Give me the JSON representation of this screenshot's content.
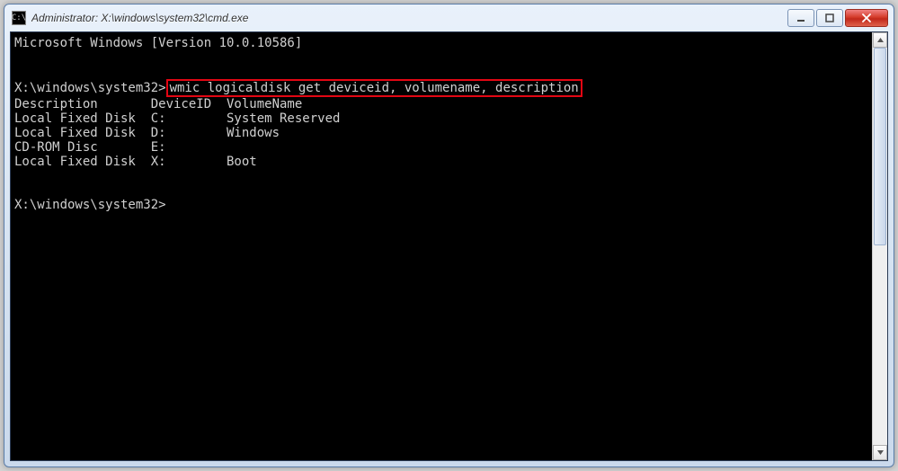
{
  "window": {
    "title": "Administrator: X:\\windows\\system32\\cmd.exe"
  },
  "terminal": {
    "version_line": "Microsoft Windows [Version 10.0.10586]",
    "prompt1_prefix": "X:\\windows\\system32>",
    "command1": "wmic logicaldisk get deviceid, volumename, description",
    "header": "Description       DeviceID  VolumeName",
    "rows": [
      "Local Fixed Disk  C:        System Reserved",
      "Local Fixed Disk  D:        Windows",
      "CD-ROM Disc       E:",
      "Local Fixed Disk  X:        Boot"
    ],
    "prompt2": "X:\\windows\\system32>"
  }
}
